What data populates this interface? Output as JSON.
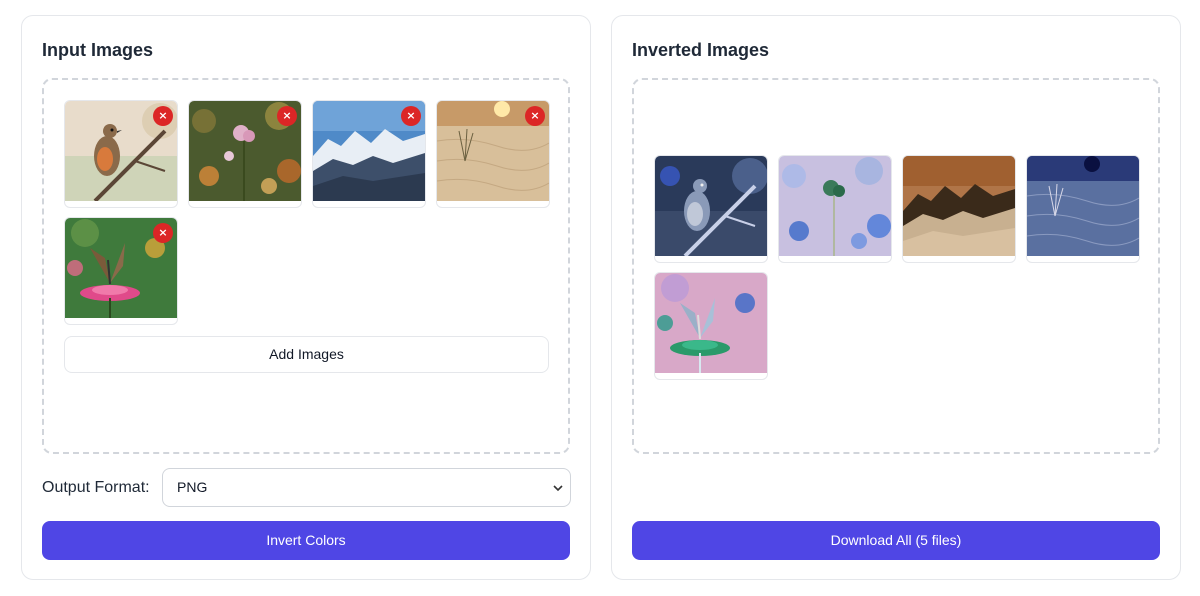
{
  "input_panel": {
    "title": "Input Images",
    "images": [
      {
        "name": "robin",
        "remove_icon": "close-icon"
      },
      {
        "name": "flower",
        "remove_icon": "close-icon"
      },
      {
        "name": "mountains",
        "remove_icon": "close-icon"
      },
      {
        "name": "desert",
        "remove_icon": "close-icon"
      },
      {
        "name": "butterfly",
        "remove_icon": "close-icon"
      }
    ],
    "remove_glyph": "×",
    "add_button": "Add Images",
    "format_label": "Output Format:",
    "format_value": "PNG",
    "invert_button": "Invert Colors"
  },
  "output_panel": {
    "title": "Inverted Images",
    "images": [
      {
        "name": "robin-inverted"
      },
      {
        "name": "flower-inverted"
      },
      {
        "name": "mountains-inverted"
      },
      {
        "name": "desert-inverted"
      },
      {
        "name": "butterfly-inverted"
      }
    ],
    "download_button": "Download All (5 files)"
  },
  "colors": {
    "accent": "#4f46e5",
    "remove": "#dc2626",
    "border": "#e5e7eb",
    "dashed": "#d1d5db"
  }
}
